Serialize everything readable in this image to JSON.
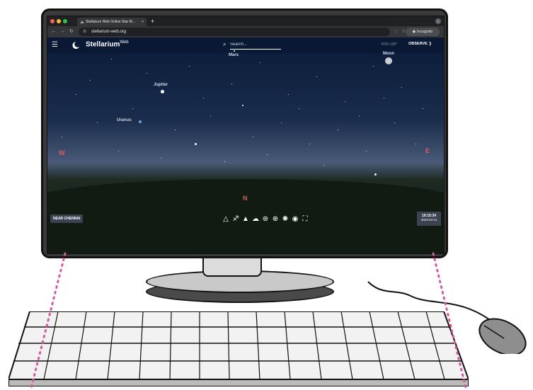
{
  "browser": {
    "tab_title": "Stellarium Web Online Star M...",
    "tab_close": "×",
    "new_tab": "+",
    "url": "stellarium-web.org",
    "incognito_label": "Incognito"
  },
  "app": {
    "brand": "Stellarium",
    "brand_suffix": "Web",
    "search_placeholder": "Search...",
    "fov": "FOV 120°",
    "observe_label": "OBSERVE ❯"
  },
  "sky": {
    "planets": [
      {
        "label": "Mars"
      },
      {
        "label": "Moon"
      },
      {
        "label": "Jupiter"
      },
      {
        "label": "Uranus"
      }
    ],
    "cardinals": {
      "west": "W",
      "north": "N",
      "east": "E"
    }
  },
  "footer": {
    "location": "NEAR CHENNAI",
    "time": "19:15:34",
    "date": "2023-04-11"
  },
  "icons": [
    "menu-icon",
    "stellarium-logo-icon",
    "search-icon",
    "constellation-lines-icon",
    "constellation-art-icon",
    "landscape-icon",
    "atmosphere-icon",
    "azimuthal-grid-icon",
    "equatorial-grid-icon",
    "deep-sky-icon",
    "night-mode-icon",
    "fullscreen-icon"
  ]
}
